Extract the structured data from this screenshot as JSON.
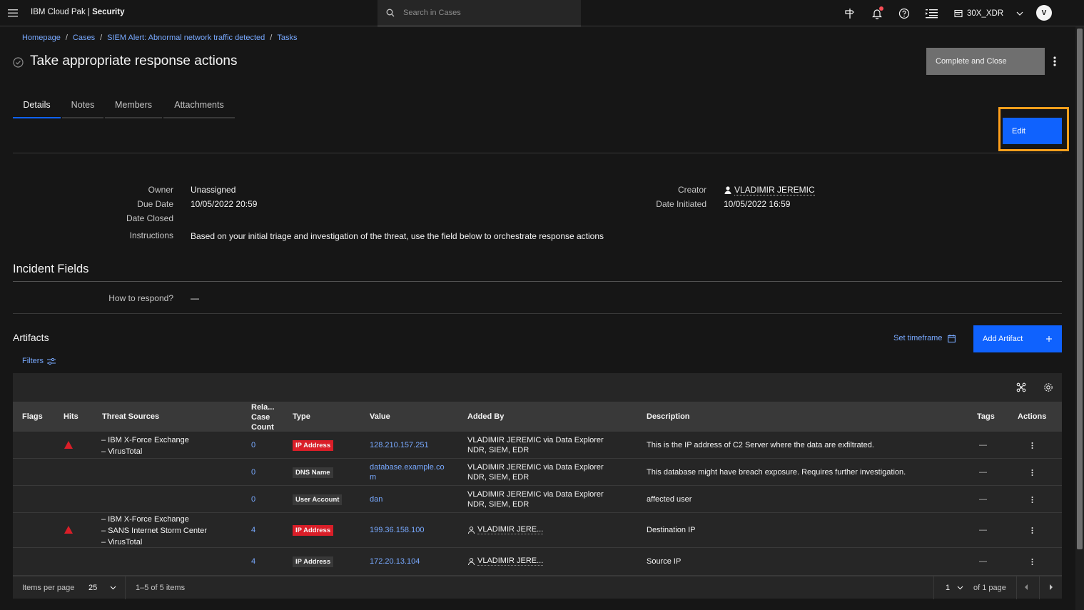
{
  "header": {
    "brand_prefix": "IBM Cloud Pak | ",
    "brand_bold": "Security",
    "search_placeholder": "Search in Cases",
    "account_name": "30X_XDR",
    "avatar_initial": "V",
    "notification_dot_color": "#fa4d56"
  },
  "breadcrumb": {
    "items": [
      "Homepage",
      "Cases",
      "SIEM Alert: Abnormal network traffic detected",
      "Tasks"
    ],
    "separator": "/"
  },
  "page": {
    "title": "Take appropriate response actions",
    "complete_button": "Complete and Close",
    "edit_button": "Edit"
  },
  "tabs": [
    "Details",
    "Notes",
    "Members",
    "Attachments"
  ],
  "details": {
    "owner_label": "Owner",
    "owner_value": "Unassigned",
    "due_label": "Due Date",
    "due_value": "10/05/2022 20:59",
    "closed_label": "Date Closed",
    "instructions_label": "Instructions",
    "instructions_value": "Based on your initial triage and investigation of the threat, use the field below to orchestrate response actions",
    "creator_label": "Creator",
    "creator_value": "VLADIMIR JEREMIC",
    "initiated_label": "Date Initiated",
    "initiated_value": "10/05/2022 16:59"
  },
  "incident_fields": {
    "title": "Incident Fields",
    "respond_label": "How to respond?",
    "respond_value": "—"
  },
  "artifacts": {
    "title": "Artifacts",
    "set_timeframe": "Set timeframe",
    "add_artifact": "Add Artifact",
    "filters": "Filters",
    "columns": {
      "flags": "Flags",
      "hits": "Hits",
      "threat_sources": "Threat Sources",
      "related_1": "Rela...",
      "related_2": "Case",
      "related_3": "Count",
      "type": "Type",
      "value": "Value",
      "added_by": "Added By",
      "description": "Description",
      "tags": "Tags",
      "actions": "Actions"
    },
    "rows": [
      {
        "sources": [
          "– IBM X-Force Exchange",
          "– VirusTotal"
        ],
        "count": "0",
        "type": "IP Address",
        "value": "128.210.157.251",
        "added_by_1": "VLADIMIR JEREMIC via Data Explorer",
        "added_by_2": "NDR, SIEM, EDR",
        "description": "This is the IP address of C2 Server where the data are exfiltrated.",
        "tags": "—"
      },
      {
        "count": "0",
        "type": "DNS Name",
        "value_1": "database.example.co",
        "value_2": "m",
        "added_by_1": "VLADIMIR JEREMIC via Data Explorer",
        "added_by_2": "NDR, SIEM, EDR",
        "description": "This database might have breach exposure. Requires further investigation.",
        "tags": "—"
      },
      {
        "count": "0",
        "type": "User Account",
        "value": "dan",
        "added_by_1": "VLADIMIR JEREMIC via Data Explorer",
        "added_by_2": "NDR, SIEM, EDR",
        "description": "affected user",
        "tags": "—"
      },
      {
        "sources": [
          "– IBM X-Force Exchange",
          "– SANS Internet Storm Center",
          "– VirusTotal"
        ],
        "count": "4",
        "type": "IP Address",
        "value": "199.36.158.100",
        "added_by": "VLADIMIR JERE...",
        "description": "Destination IP",
        "tags": "—"
      },
      {
        "count": "4",
        "type": "IP Address",
        "value": "172.20.13.104",
        "added_by": "VLADIMIR JERE...",
        "description": "Source IP",
        "tags": "—"
      }
    ]
  },
  "pagination": {
    "items_per_page_label": "Items per page",
    "items_per_page": "25",
    "range": "1–5 of 5 items",
    "page": "1",
    "of_pages": "of 1 page"
  },
  "colors": {
    "background": "#161616",
    "layer": "#262626",
    "primary": "#0f62fe",
    "link": "#78a9ff",
    "danger": "#da1e28",
    "highlight": "#ff9f1c"
  }
}
